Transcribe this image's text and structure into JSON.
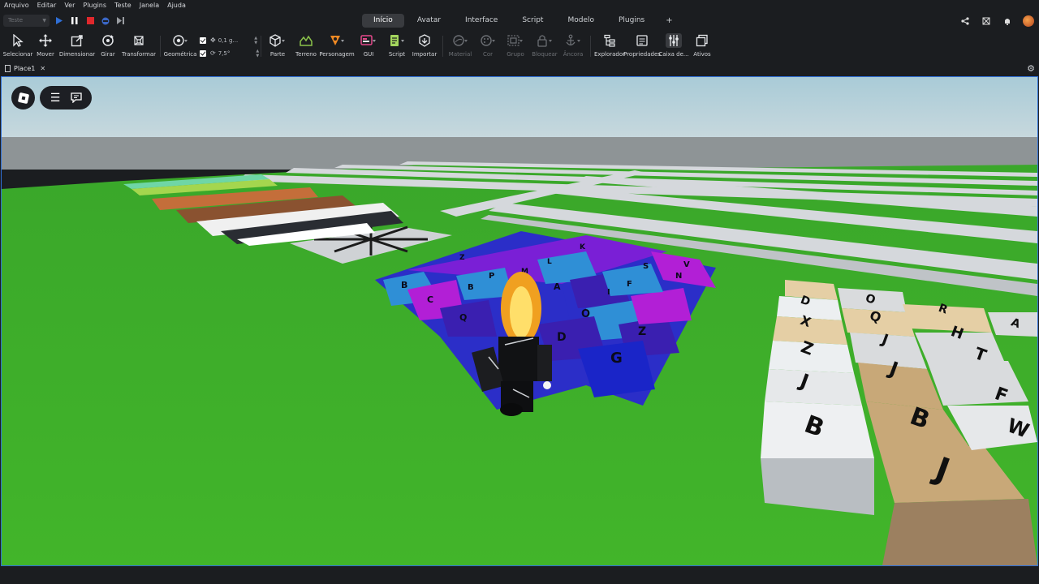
{
  "menu": [
    "Arquivo",
    "Editar",
    "Ver",
    "Plugins",
    "Teste",
    "Janela",
    "Ajuda"
  ],
  "tabs": [
    {
      "label": "Início",
      "active": true
    },
    {
      "label": "Avatar",
      "active": false
    },
    {
      "label": "Interface",
      "active": false
    },
    {
      "label": "Script",
      "active": false
    },
    {
      "label": "Modelo",
      "active": false
    },
    {
      "label": "Plugins",
      "active": false
    },
    {
      "label": "+",
      "active": false
    }
  ],
  "playbar": {
    "mode": "Teste"
  },
  "toolbar": {
    "selecionar": "Selecionar",
    "mover": "Mover",
    "dimensionar": "Dimensionar",
    "girar": "Girar",
    "transformar": "Transformar",
    "geometrica": "Geométrica",
    "snap_move": "0,1 g...",
    "snap_rotate": "7,5°",
    "parte": "Parte",
    "terreno": "Terreno",
    "personagem": "Personagem",
    "gui": "GUI",
    "script": "Script",
    "importar": "Importar",
    "material": "Material",
    "cor": "Cor",
    "grupo": "Grupo",
    "bloquear": "Bloquear",
    "ancora": "Âncora",
    "explorador": "Explorador",
    "propriedades": "Propriedades",
    "caixa": "Caixa de...",
    "ativos": "Ativos"
  },
  "document": {
    "tab": "Place1"
  },
  "colors": {
    "accent": "#2f6fd6",
    "chrome": "#1b1d20",
    "orange_icon": "#f08a24",
    "green_icon": "#8bc34a",
    "pink_icon": "#e64a8c",
    "lime_icon": "#a4d65e",
    "record_red": "#e0282c",
    "grass": "#42b52a",
    "sky": "#b9d3dc"
  },
  "scene": {
    "front_keys": [
      "B",
      "J",
      "B",
      "J",
      "J",
      "Z",
      "X",
      "D",
      "F",
      "W",
      "T",
      "H",
      "O",
      "Q",
      "R",
      "J",
      "A"
    ],
    "center_keys": [
      "B",
      "C",
      "Q",
      "D",
      "G",
      "Z",
      "O",
      "A",
      "P",
      "B",
      "Z",
      "N",
      "I",
      "S",
      "F",
      "V",
      "K",
      "L",
      "M"
    ]
  }
}
